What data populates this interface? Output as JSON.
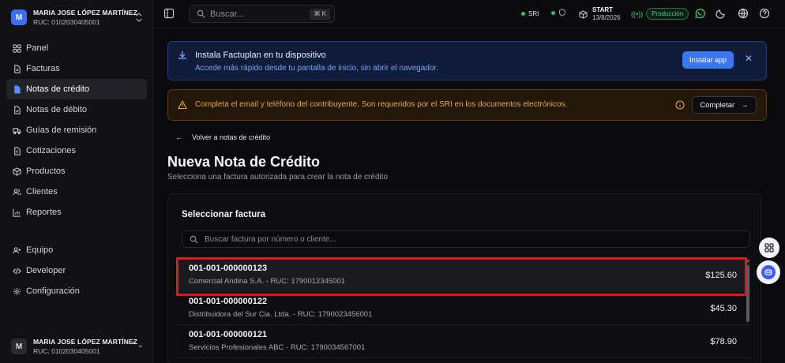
{
  "workspace": {
    "initial": "M",
    "name": "MARIA JOSE LÓPEZ MARTÍNEZ",
    "ruc": "RUC: 0102030405001"
  },
  "sidebar": {
    "items": [
      {
        "label": "Panel",
        "icon": "grid-icon"
      },
      {
        "label": "Facturas",
        "icon": "file-icon"
      },
      {
        "label": "Notas de crédito",
        "icon": "file-credit-icon",
        "active": true
      },
      {
        "label": "Notas de débito",
        "icon": "file-debit-icon"
      },
      {
        "label": "Guías de remisión",
        "icon": "truck-icon"
      },
      {
        "label": "Cotizaciones",
        "icon": "file-quote-icon"
      },
      {
        "label": "Productos",
        "icon": "box-icon"
      },
      {
        "label": "Clientes",
        "icon": "users-icon"
      },
      {
        "label": "Reportes",
        "icon": "chart-icon"
      }
    ],
    "items2": [
      {
        "label": "Equipo",
        "icon": "user-plus-icon"
      },
      {
        "label": "Developer",
        "icon": "code-icon"
      },
      {
        "label": "Configuración",
        "icon": "settings-icon"
      }
    ]
  },
  "user": {
    "initial": "M",
    "name": "MARIA JOSE LÓPEZ MARTÍNEZ",
    "ruc": "RUC: 0102030405001"
  },
  "topbar": {
    "search_placeholder": "Buscar...",
    "shortcut": "⌘ K",
    "sri": "SRI",
    "plan": "START",
    "plan_date": "13/8/2026",
    "environment": "Producción"
  },
  "install_banner": {
    "title": "Instala Factuplan en tu dispositivo",
    "text": "Accede más rápido desde tu pantalla de inicio, sin abrir el navegador.",
    "button": "Instalar app"
  },
  "warning_banner": {
    "text": "Completa el email y teléfono del contribuyente. Son requeridos por el SRI en los documentos electrónicos.",
    "button": "Completar"
  },
  "page": {
    "back": "Volver a notas de crédito",
    "title": "Nueva Nota de Crédito",
    "subtitle": "Selecciona una factura autorizada para crear la nota de crédito"
  },
  "card": {
    "title": "Seleccionar factura",
    "search_placeholder": "Buscar factura por número o cliente...",
    "invoices": [
      {
        "number": "001-001-000000123",
        "client": "Comercial Andina S.A. - RUC: 1790012345001",
        "amount": "$125.60"
      },
      {
        "number": "001-001-000000122",
        "client": "Distribuidora del Sur Cia. Ltda. - RUC: 1790023456001",
        "amount": "$45.30"
      },
      {
        "number": "001-001-000000121",
        "client": "Servicios Profesionales ABC - RUC: 1790034567001",
        "amount": "$78.90"
      }
    ]
  },
  "colors": {
    "accent": "#3b78f0",
    "success": "#22c55e",
    "warning": "#f0a12e",
    "highlight": "#e3171c"
  }
}
